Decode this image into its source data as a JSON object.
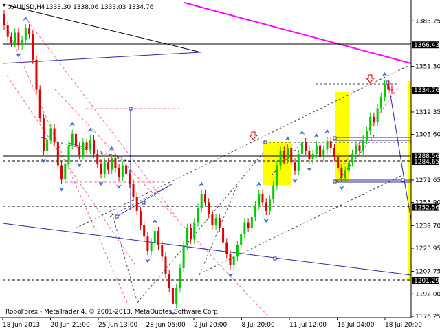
{
  "header": {
    "symbol": "XAUUSD,H4",
    "ohlc": "1333.30 1338.06 1333.03 1334.76"
  },
  "footer": {
    "copyright": "RoboForex - MetaTrader 4, © 2001-2013, MetaQuotes Software Corp."
  },
  "colors": {
    "background": "#ffffff",
    "bull": "#00cc00",
    "bear": "#e00000",
    "fibo_magenta": "#ff00ff",
    "dashed_red": "#ff6699",
    "pattern_blue": "#2a2aa8",
    "signal_blue": "#3b6ecf",
    "yellow_zone": "#ffff00",
    "gray_axis": "#666666"
  },
  "chart_data": {
    "type": "candlestick",
    "title": "XAUUSD,H4",
    "ylim": [
      1176.25,
      1394.0
    ],
    "y_ticks": [
      "1383.25",
      "1351.30",
      "1319.35",
      "1303.60",
      "1271.65",
      "1255.90",
      "1239.70",
      "1223.95",
      "1207.75",
      "1192.00",
      "1176.25"
    ],
    "y_labels_boxed": [
      {
        "label": "1366.43",
        "value": 1366.43
      },
      {
        "label": "1334.76",
        "value": 1334.76
      },
      {
        "label": "1288.56",
        "value": 1288.56
      },
      {
        "label": "1284.65",
        "value": 1284.65
      },
      {
        "label": "1252.56",
        "value": 1252.56
      },
      {
        "label": "1201.29",
        "value": 1201.29
      }
    ],
    "x_ticks": [
      "18 Jun 2013",
      "20 Jun 21:00",
      "25 Jun 13:00",
      "28 Jun 05:00",
      "2 Jul 20:00",
      "8 Jul 20:00",
      "11 Jul 12:00",
      "16 Jul 04:00",
      "18 Jul 20:00"
    ],
    "candles": [
      {
        "o": 1388,
        "c": 1380
      },
      {
        "o": 1380,
        "c": 1372
      },
      {
        "o": 1372,
        "c": 1368
      },
      {
        "o": 1368,
        "c": 1375
      },
      {
        "o": 1375,
        "c": 1366
      },
      {
        "o": 1366,
        "c": 1370
      },
      {
        "o": 1370,
        "c": 1378
      },
      {
        "o": 1378,
        "c": 1374
      },
      {
        "o": 1374,
        "c": 1356
      },
      {
        "o": 1356,
        "c": 1335
      },
      {
        "o": 1335,
        "c": 1315
      },
      {
        "o": 1315,
        "c": 1292
      },
      {
        "o": 1292,
        "c": 1300
      },
      {
        "o": 1300,
        "c": 1308
      },
      {
        "o": 1308,
        "c": 1298
      },
      {
        "o": 1298,
        "c": 1282
      },
      {
        "o": 1282,
        "c": 1272
      },
      {
        "o": 1272,
        "c": 1283
      },
      {
        "o": 1283,
        "c": 1296
      },
      {
        "o": 1296,
        "c": 1304
      },
      {
        "o": 1304,
        "c": 1295
      },
      {
        "o": 1295,
        "c": 1289
      },
      {
        "o": 1289,
        "c": 1298
      },
      {
        "o": 1298,
        "c": 1293
      },
      {
        "o": 1293,
        "c": 1300
      },
      {
        "o": 1300,
        "c": 1290
      },
      {
        "o": 1290,
        "c": 1283
      },
      {
        "o": 1283,
        "c": 1276
      },
      {
        "o": 1276,
        "c": 1284
      },
      {
        "o": 1284,
        "c": 1279
      },
      {
        "o": 1279,
        "c": 1287
      },
      {
        "o": 1287,
        "c": 1280
      },
      {
        "o": 1280,
        "c": 1274
      },
      {
        "o": 1274,
        "c": 1282
      },
      {
        "o": 1282,
        "c": 1276
      },
      {
        "o": 1276,
        "c": 1269
      },
      {
        "o": 1269,
        "c": 1260
      },
      {
        "o": 1260,
        "c": 1250
      },
      {
        "o": 1250,
        "c": 1240
      },
      {
        "o": 1240,
        "c": 1232
      },
      {
        "o": 1232,
        "c": 1222
      },
      {
        "o": 1222,
        "c": 1228
      },
      {
        "o": 1228,
        "c": 1236
      },
      {
        "o": 1236,
        "c": 1226
      },
      {
        "o": 1226,
        "c": 1218
      },
      {
        "o": 1218,
        "c": 1206
      },
      {
        "o": 1206,
        "c": 1196
      },
      {
        "o": 1196,
        "c": 1185
      },
      {
        "o": 1185,
        "c": 1196
      },
      {
        "o": 1196,
        "c": 1210
      },
      {
        "o": 1210,
        "c": 1226
      },
      {
        "o": 1226,
        "c": 1238
      },
      {
        "o": 1238,
        "c": 1230
      },
      {
        "o": 1230,
        "c": 1242
      },
      {
        "o": 1242,
        "c": 1252
      },
      {
        "o": 1252,
        "c": 1262
      },
      {
        "o": 1262,
        "c": 1256
      },
      {
        "o": 1256,
        "c": 1248
      },
      {
        "o": 1248,
        "c": 1240
      },
      {
        "o": 1240,
        "c": 1245
      },
      {
        "o": 1245,
        "c": 1238
      },
      {
        "o": 1238,
        "c": 1228
      },
      {
        "o": 1228,
        "c": 1220
      },
      {
        "o": 1220,
        "c": 1212
      },
      {
        "o": 1212,
        "c": 1218
      },
      {
        "o": 1218,
        "c": 1226
      },
      {
        "o": 1226,
        "c": 1234
      },
      {
        "o": 1234,
        "c": 1242
      },
      {
        "o": 1242,
        "c": 1238
      },
      {
        "o": 1238,
        "c": 1246
      },
      {
        "o": 1246,
        "c": 1254
      },
      {
        "o": 1254,
        "c": 1262
      },
      {
        "o": 1262,
        "c": 1256
      },
      {
        "o": 1256,
        "c": 1250
      },
      {
        "o": 1250,
        "c": 1258
      },
      {
        "o": 1258,
        "c": 1268
      },
      {
        "o": 1268,
        "c": 1282
      },
      {
        "o": 1282,
        "c": 1292
      },
      {
        "o": 1292,
        "c": 1286
      },
      {
        "o": 1286,
        "c": 1294
      },
      {
        "o": 1294,
        "c": 1284
      },
      {
        "o": 1284,
        "c": 1278
      },
      {
        "o": 1278,
        "c": 1290
      },
      {
        "o": 1290,
        "c": 1298
      },
      {
        "o": 1298,
        "c": 1292
      },
      {
        "o": 1292,
        "c": 1286
      },
      {
        "o": 1286,
        "c": 1290
      },
      {
        "o": 1290,
        "c": 1296
      },
      {
        "o": 1296,
        "c": 1288
      },
      {
        "o": 1288,
        "c": 1293
      },
      {
        "o": 1293,
        "c": 1299
      },
      {
        "o": 1299,
        "c": 1294
      },
      {
        "o": 1294,
        "c": 1288
      },
      {
        "o": 1288,
        "c": 1280
      },
      {
        "o": 1280,
        "c": 1273
      },
      {
        "o": 1273,
        "c": 1278
      },
      {
        "o": 1278,
        "c": 1284
      },
      {
        "o": 1284,
        "c": 1290
      },
      {
        "o": 1290,
        "c": 1296
      },
      {
        "o": 1296,
        "c": 1292
      },
      {
        "o": 1292,
        "c": 1300
      },
      {
        "o": 1300,
        "c": 1306
      },
      {
        "o": 1306,
        "c": 1316
      },
      {
        "o": 1316,
        "c": 1312
      },
      {
        "o": 1312,
        "c": 1322
      },
      {
        "o": 1322,
        "c": 1330
      },
      {
        "o": 1330,
        "c": 1339
      },
      {
        "o": 1339,
        "c": 1335
      },
      {
        "o": 1335,
        "c": 1334.76
      }
    ]
  }
}
